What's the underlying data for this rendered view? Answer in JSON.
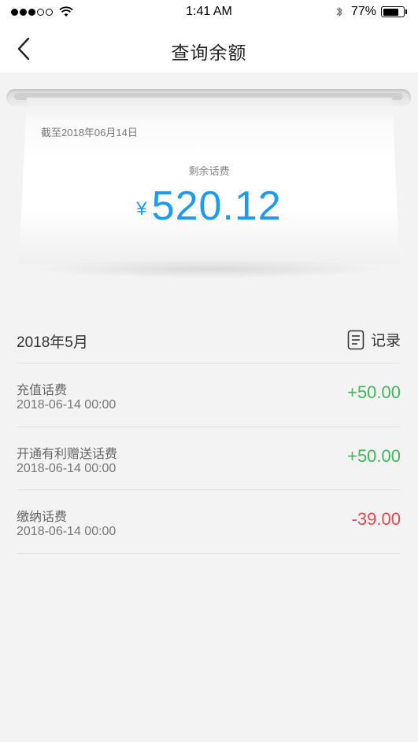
{
  "status_bar": {
    "time": "1:41 AM",
    "battery_percent": "77%",
    "battery_level": 0.77,
    "signal_icon": "signal-dots-icon",
    "wifi_icon": "wifi-icon",
    "bluetooth_icon": "bluetooth-icon"
  },
  "nav": {
    "title": "查询余额",
    "back_icon": "chevron-left-icon"
  },
  "receipt": {
    "as_of": "截至2018年06月14日",
    "label": "剩余话费",
    "currency": "¥",
    "amount": "520.12"
  },
  "section": {
    "month": "2018年5月",
    "records_label": "记录",
    "records_icon": "document-list-icon"
  },
  "transactions": [
    {
      "name": "充值话费",
      "time": "2018-06-14 00:00",
      "amount": "+50.00",
      "type": "positive"
    },
    {
      "name": "开通有利赠送话费",
      "time": "2018-06-14 00:00",
      "amount": "+50.00",
      "type": "positive"
    },
    {
      "name": "缴纳话费",
      "time": "2018-06-14 00:00",
      "amount": "-39.00",
      "type": "negative"
    }
  ],
  "colors": {
    "accent": "#1d9bf0",
    "positive": "#3fb858",
    "negative": "#e8474c"
  }
}
